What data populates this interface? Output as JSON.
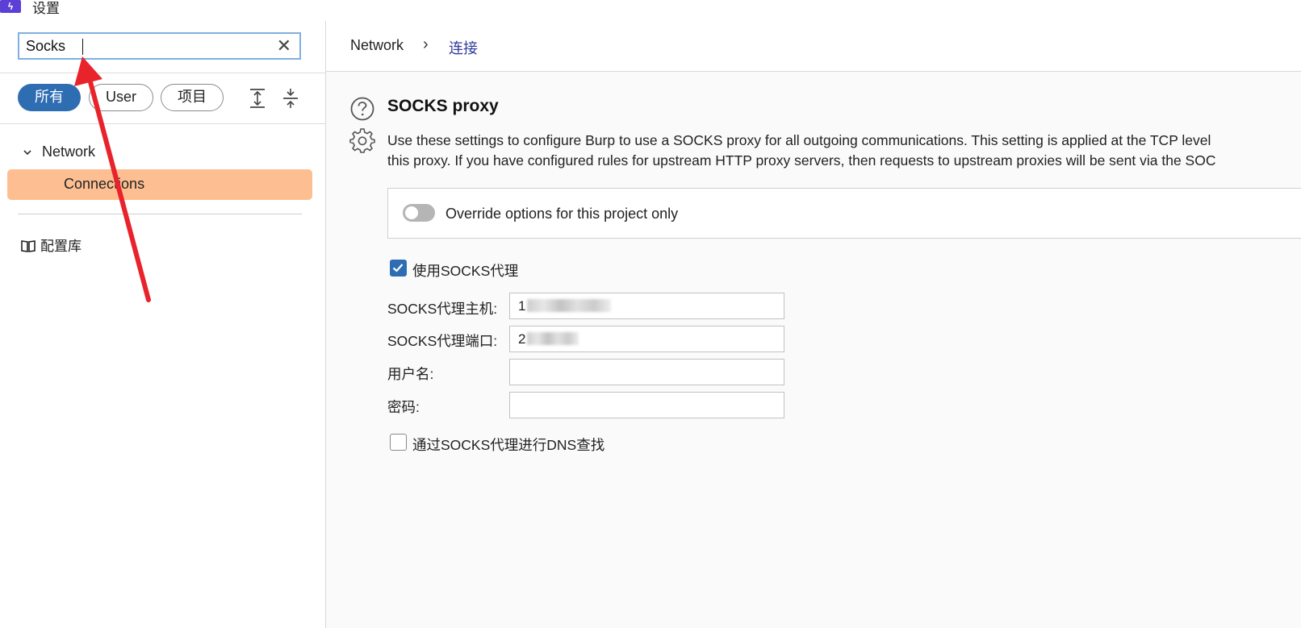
{
  "window": {
    "title": "设置",
    "logo_glyph": "ϟ"
  },
  "search": {
    "value": "Socks",
    "clear_glyph": "✕"
  },
  "filters": {
    "all": "所有",
    "user": "User",
    "project": "项目"
  },
  "tree": {
    "network": "Network",
    "connections": "Connections",
    "library": "配置库"
  },
  "breadcrumb": {
    "parent": "Network",
    "separator": "›",
    "current": "连接"
  },
  "section": {
    "title": "SOCKS proxy",
    "description_line1": "Use these settings to configure Burp to use a SOCKS proxy for all outgoing communications. This setting is applied at the TCP level",
    "description_line2": "this proxy. If you have configured rules for upstream HTTP proxy servers, then requests to upstream proxies will be sent via the SOC"
  },
  "override": {
    "label": "Override options for this project only",
    "enabled": false
  },
  "use_socks": {
    "label": "使用SOCKS代理",
    "checked": true
  },
  "fields": {
    "host_label": "SOCKS代理主机:",
    "host_value_prefix": "1",
    "port_label": "SOCKS代理端口:",
    "port_value_prefix": "2",
    "username_label": "用户名:",
    "username_value": "",
    "password_label": "密码:",
    "password_value": ""
  },
  "dns": {
    "label": "通过SOCKS代理进行DNS查找",
    "checked": false
  },
  "colors": {
    "accent": "#2f6db3",
    "selected_item": "#fdbf92",
    "annotation_arrow": "#e8232b",
    "breadcrumb_current": "#2f3b9a"
  },
  "icons": [
    "app-logo-icon",
    "close-icon",
    "expand-all-icon",
    "collapse-all-icon",
    "chevron-down-icon",
    "book-icon",
    "chevron-right-icon",
    "help-icon",
    "gear-icon",
    "check-icon"
  ]
}
